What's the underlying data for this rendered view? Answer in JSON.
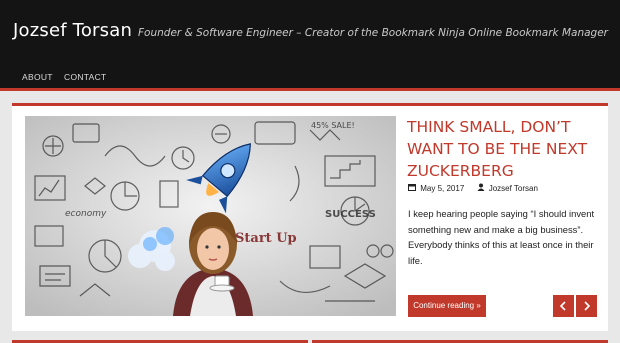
{
  "site": {
    "title": "Jozsef Torsan",
    "tagline": "Founder & Software Engineer – Creator of the Bookmark Ninja Online Bookmark Manager"
  },
  "nav": {
    "items": [
      {
        "label": "ABOUT"
      },
      {
        "label": "CONTACT"
      }
    ]
  },
  "hero": {
    "image_text": {
      "start_up": "Start Up",
      "success": "SUCCESS",
      "sale": "45% SALE!",
      "economy": "economy"
    }
  },
  "post": {
    "title": "THINK SMALL, DON’T WANT TO BE THE NEXT ZUCKERBERG",
    "date": "May 5, 2017",
    "author": "Jozsef Torsan",
    "excerpt": "I keep hearing people saying “I should invent something new and make a big business”. Everybody thinks of this at least once in their life.",
    "read_more": "Continue reading »"
  },
  "slider": {
    "prev_icon": "chevron-left-icon",
    "next_icon": "chevron-right-icon"
  },
  "colors": {
    "accent": "#c0392b",
    "header_bg": "#141414",
    "page_bg": "#e8e8e8"
  }
}
